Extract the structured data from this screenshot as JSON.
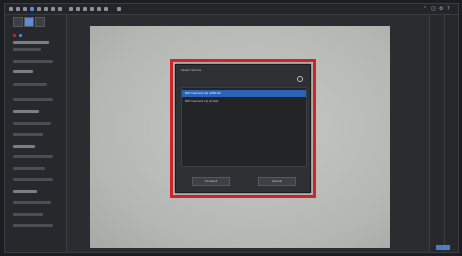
{
  "toolbar": {
    "tools": [
      "select-tool",
      "pan-tool",
      "zoom-tool",
      "crop-tool",
      "rotate-tool",
      "measure-tool",
      "text-tool",
      "brush-tool",
      "shape-tool",
      "fill-tool",
      "stamp-tool",
      "eyedropper-tool",
      "grid-tool",
      "ruler-tool",
      "camera-tool"
    ],
    "active_tool_index": 3,
    "right_icons": [
      "pin-icon",
      "split-icon",
      "settings-icon",
      "help-icon"
    ]
  },
  "dialog": {
    "title": "Select device",
    "items": [
      {
        "label": "PAT Camera (0) AMR-02",
        "selected": true
      },
      {
        "label": "PAT Camera (1) (0-6A)",
        "selected": false
      }
    ],
    "buttons": {
      "ok": "Connect",
      "cancel": "Cancel"
    }
  },
  "colors": {
    "highlight": "#d2232a",
    "selection": "#2b63b8",
    "accent": "#4d8fe0"
  }
}
